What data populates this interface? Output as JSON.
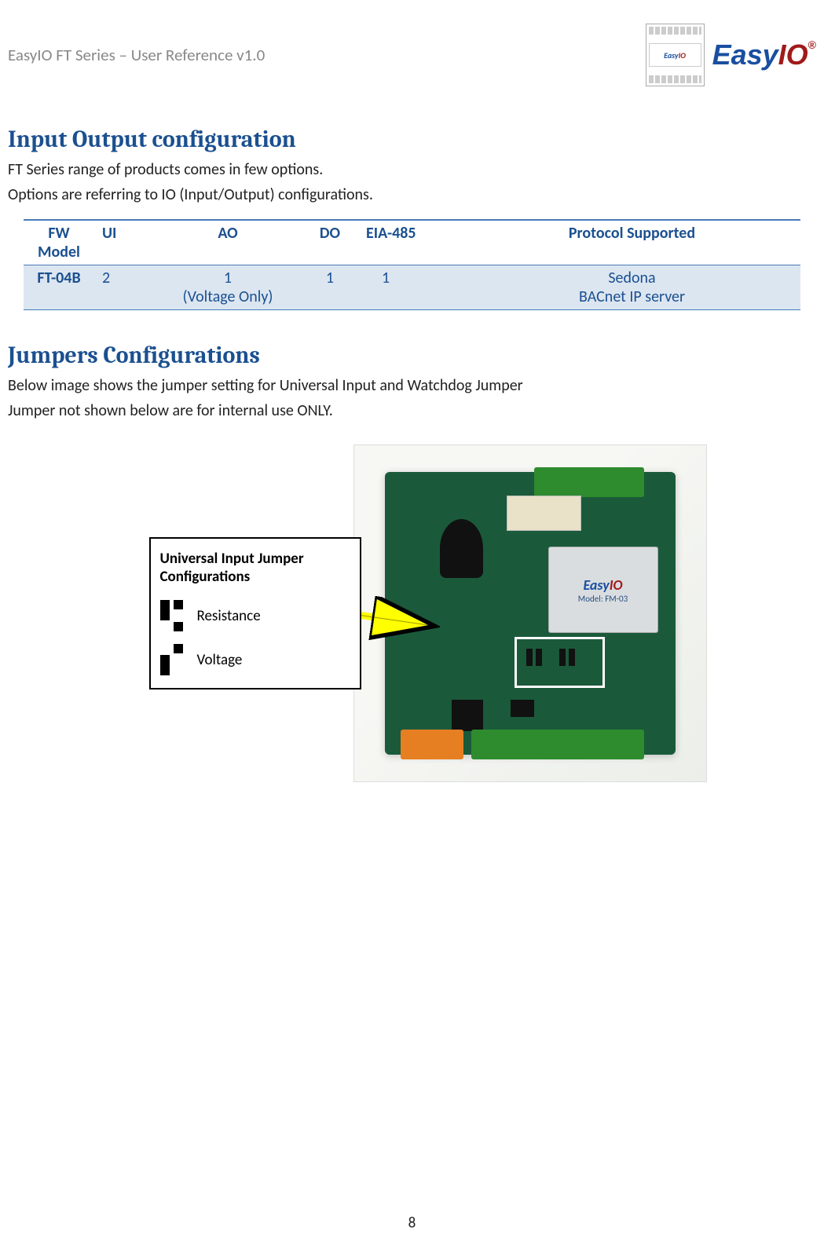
{
  "header": {
    "doc_title": "EasyIO FT Series – User Reference v1.0",
    "logo_brand_a": "Easy",
    "logo_brand_b": "IO",
    "logo_reg": "®"
  },
  "section1": {
    "heading": "Input Output configuration",
    "para1": "FT Series range of products comes in few options.",
    "para2": "Options are referring to IO (Input/Output) configurations."
  },
  "table": {
    "headers": {
      "col1a": "FW",
      "col1b": "Model",
      "col2": "UI",
      "col3": "AO",
      "col4": "DO",
      "col5": "EIA-485",
      "col6": "Protocol Supported"
    },
    "row1": {
      "model": "FT-04B",
      "ui": "2",
      "ao_a": "1",
      "ao_b": "(Voltage Only)",
      "do": "1",
      "eia": "1",
      "proto_a": "Sedona",
      "proto_b": "BACnet IP server"
    }
  },
  "section2": {
    "heading": "Jumpers Configurations",
    "para1": "Below image shows the jumper setting for Universal Input and Watchdog Jumper",
    "para2": "Jumper not shown below are for internal use ONLY."
  },
  "jumper_legend": {
    "title": "Universal Input Jumper Configurations",
    "row1": "Resistance",
    "row2": "Voltage"
  },
  "module_label": {
    "brand": "EasyIO",
    "model": "Model: FM-03"
  },
  "page_number": "8"
}
